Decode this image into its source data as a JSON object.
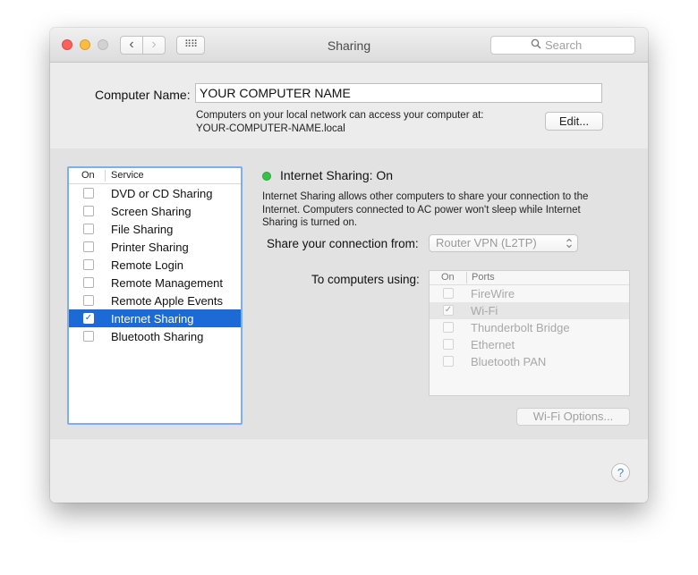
{
  "window": {
    "title": "Sharing",
    "back_glyph": "‹",
    "forward_glyph": "›",
    "grid_glyph": "⠿⠿",
    "search_placeholder": "Search"
  },
  "computer_name": {
    "label": "Computer Name:",
    "value": "YOUR COMPUTER NAME",
    "description_line1": "Computers on your local network can access your computer at:",
    "description_line2": "YOUR-COMPUTER-NAME.local",
    "edit_button": "Edit..."
  },
  "services": {
    "header_on": "On",
    "header_service": "Service",
    "items": [
      {
        "label": "DVD or CD Sharing",
        "checked": false,
        "check": ""
      },
      {
        "label": "Screen Sharing",
        "checked": false,
        "check": ""
      },
      {
        "label": "File Sharing",
        "checked": false,
        "check": ""
      },
      {
        "label": "Printer Sharing",
        "checked": false,
        "check": ""
      },
      {
        "label": "Remote Login",
        "checked": false,
        "check": ""
      },
      {
        "label": "Remote Management",
        "checked": false,
        "check": ""
      },
      {
        "label": "Remote Apple Events",
        "checked": false,
        "check": ""
      },
      {
        "label": "Internet Sharing",
        "checked": true,
        "check": "✓"
      },
      {
        "label": "Bluetooth Sharing",
        "checked": false,
        "check": ""
      }
    ]
  },
  "detail": {
    "status": "Internet Sharing: On",
    "status_color": "#36c24a",
    "description": "Internet Sharing allows other computers to share your connection to the Internet. Computers connected to AC power won't sleep while Internet Sharing is turned on.",
    "share_from_label": "Share your connection from:",
    "share_from_value": "Router VPN (L2TP)",
    "to_computers_label": "To computers using:",
    "ports_header_on": "On",
    "ports_header_ports": "Ports",
    "ports": [
      {
        "label": "FireWire",
        "checked": false,
        "check": ""
      },
      {
        "label": "Wi-Fi",
        "checked": true,
        "check": "✓"
      },
      {
        "label": "Thunderbolt Bridge",
        "checked": false,
        "check": ""
      },
      {
        "label": "Ethernet",
        "checked": false,
        "check": ""
      },
      {
        "label": "Bluetooth PAN",
        "checked": false,
        "check": ""
      }
    ],
    "wifi_options_button": "Wi-Fi Options..."
  },
  "help_glyph": "?",
  "colors": {
    "selection": "#1b6ad6",
    "list_focus_border": "#7daef1"
  }
}
